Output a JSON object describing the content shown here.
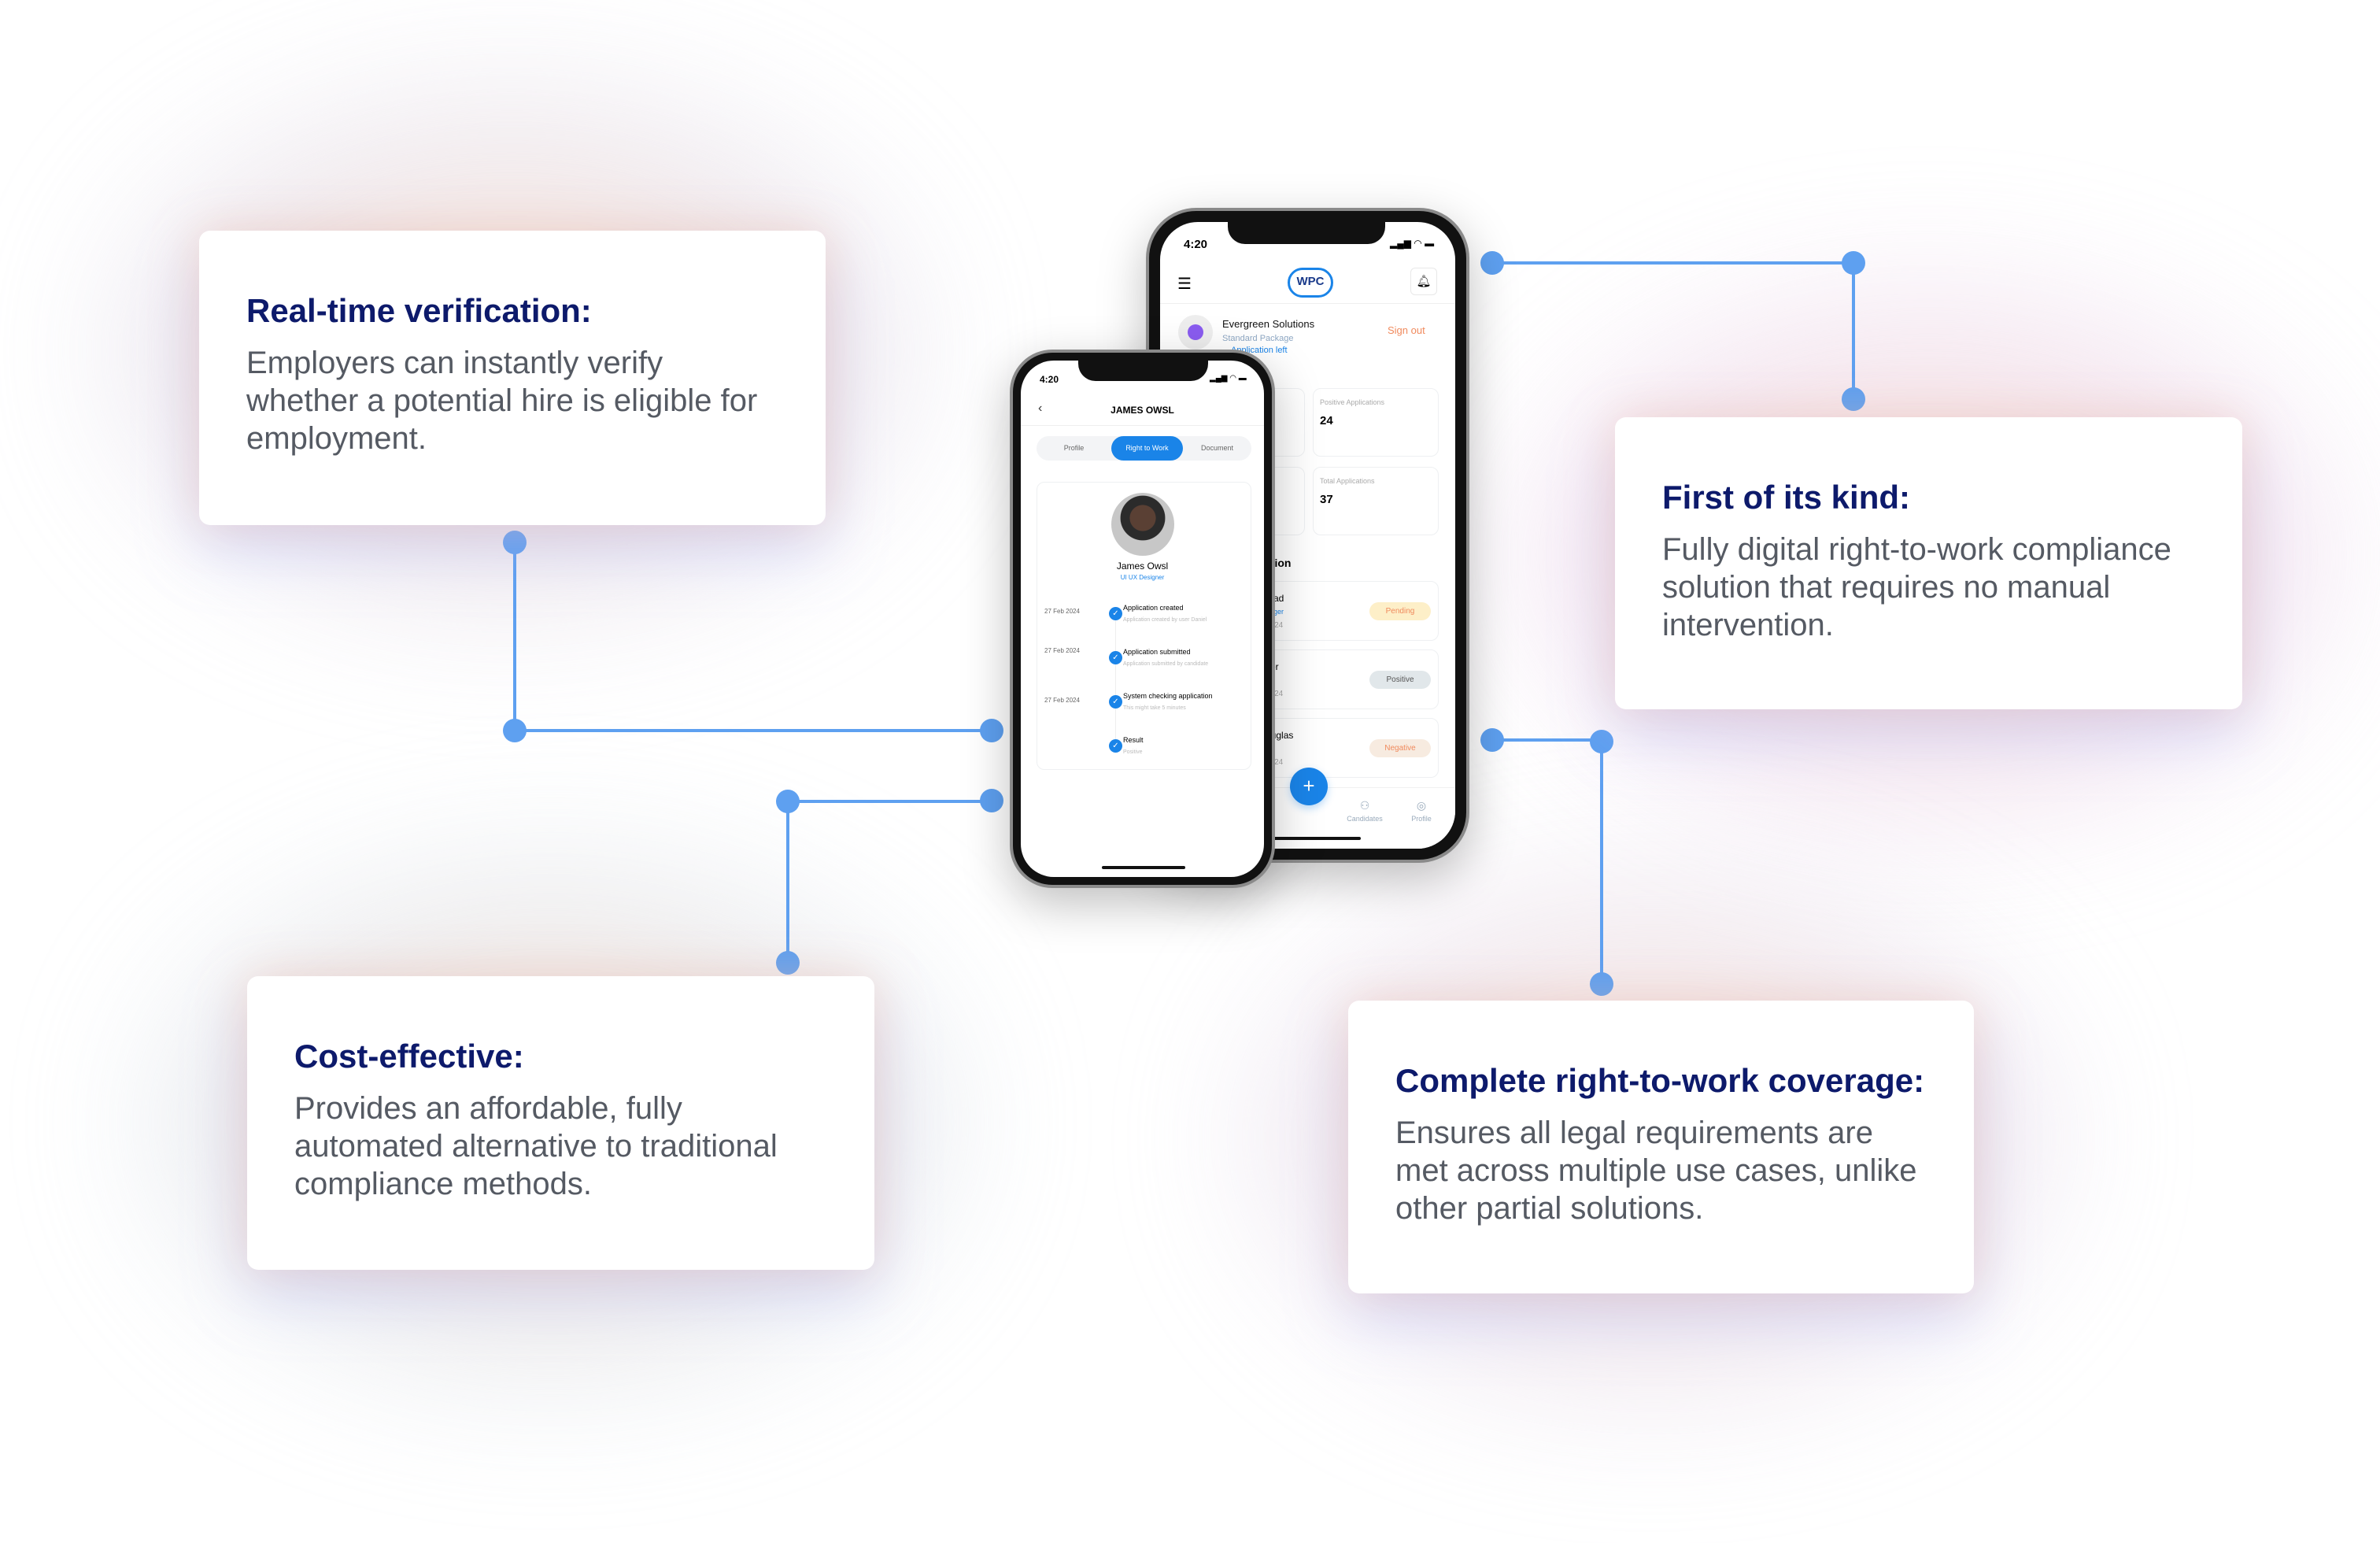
{
  "colors": {
    "accent": "#1a84e8",
    "connector": "#5ea0f0",
    "title": "#0d1a6b",
    "sign_out": "#f08a5d"
  },
  "features": [
    {
      "title": "Real-time verification:",
      "body": "Employers can instantly verify whether a potential hire is eligible for employment."
    },
    {
      "title": "First of its kind:",
      "body": "Fully digital right-to-work compliance solution that requires no manual intervention."
    },
    {
      "title": "Cost-effective:",
      "body": "Provides an affordable, fully automated alternative to traditional compliance methods."
    },
    {
      "title": "Complete right-to-work coverage:",
      "body": "Ensures all legal requirements are met across multiple use cases, unlike other partial solutions."
    }
  ],
  "back_phone": {
    "time": "4:20",
    "logo_text": "WPC Right2Work",
    "company": "Evergreen Solutions",
    "package": "Standard Package",
    "applications_left": "Application left",
    "sign_out": "Sign out",
    "stats": [
      {
        "label": "Positive Applications",
        "value": "24"
      },
      {
        "label": "Total Applications",
        "value": "37"
      }
    ],
    "section_fragment": "ation",
    "applications": [
      {
        "name": "mad",
        "role": "nager",
        "date": "2024",
        "status": "Pending"
      },
      {
        "name": "ver",
        "role": "ef",
        "date": "2024",
        "status": "Positive"
      },
      {
        "name": "ouglas",
        "role": "",
        "date": "2024",
        "status": "Negative"
      }
    ],
    "nav": {
      "candidates": "Candidates",
      "profile": "Profile"
    },
    "fab": "+"
  },
  "front_phone": {
    "time": "4:20",
    "title": "JAMES OWSL",
    "tabs": [
      "Profile",
      "Right to Work",
      "Document"
    ],
    "active_tab": "Right to Work",
    "name": "James Owsl",
    "role": "UI UX Designer",
    "timeline": [
      {
        "date": "27 Feb 2024",
        "title": "Application created",
        "subtitle": "Application  created by user Daniel"
      },
      {
        "date": "27 Feb 2024",
        "title": "Application submitted",
        "subtitle": "Application submitted  by candidate"
      },
      {
        "date": "27 Feb 2024",
        "title": "System checking application",
        "subtitle": "This might take 5 minutes"
      },
      {
        "date": "",
        "title": "Result",
        "subtitle": "Positive"
      }
    ]
  }
}
